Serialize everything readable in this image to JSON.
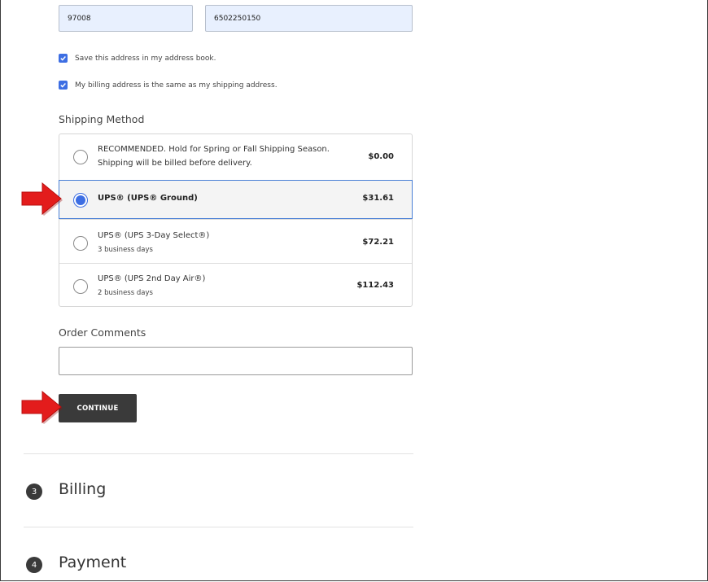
{
  "address": {
    "zip_value": "97008",
    "phone_value": "6502250150"
  },
  "options": {
    "save_address_label": "Save this address in my address book.",
    "billing_same_label": "My billing address is the same as my shipping address."
  },
  "shipping": {
    "heading": "Shipping Method",
    "methods": [
      {
        "title_line1": "RECOMMENDED. Hold for Spring or Fall Shipping Season.",
        "title_line2": "Shipping will be billed before delivery.",
        "price": "$0.00",
        "selected": false
      },
      {
        "title": "UPS® (UPS® Ground)",
        "price": "$31.61",
        "selected": true
      },
      {
        "title": "UPS® (UPS 3-Day Select®)",
        "subtitle": "3 business days",
        "price": "$72.21",
        "selected": false
      },
      {
        "title": "UPS® (UPS 2nd Day Air®)",
        "subtitle": "2 business days",
        "price": "$112.43",
        "selected": false
      }
    ]
  },
  "comments": {
    "heading": "Order Comments",
    "value": ""
  },
  "actions": {
    "continue_label": "CONTINUE"
  },
  "steps": [
    {
      "number": "3",
      "title": "Billing"
    },
    {
      "number": "4",
      "title": "Payment"
    }
  ],
  "colors": {
    "accent": "#3d6ee3",
    "selected_border": "#4a80d6",
    "button_bg": "#3a3a3a",
    "annotation_arrow": "#e31c1c"
  }
}
